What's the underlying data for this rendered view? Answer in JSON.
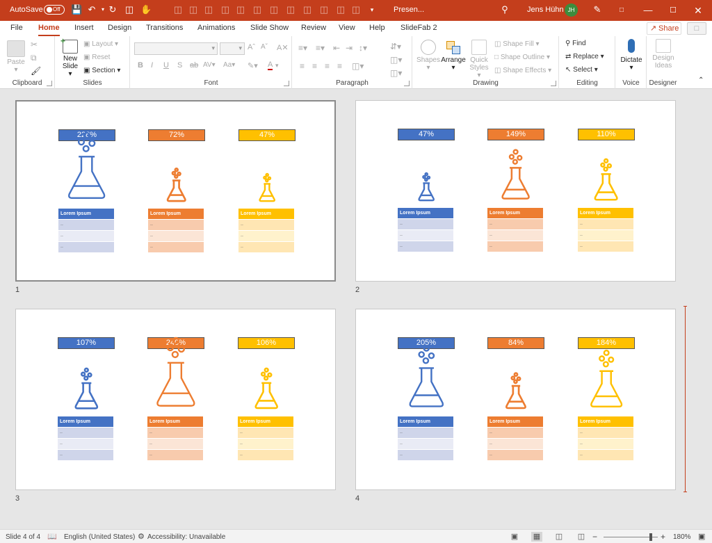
{
  "titlebar": {
    "autosave": "AutoSave",
    "toggle": "Off",
    "filename": "Presen...",
    "user": "Jens Hühn",
    "initials": "JH"
  },
  "tabs": [
    "File",
    "Home",
    "Insert",
    "Design",
    "Transitions",
    "Animations",
    "Slide Show",
    "Review",
    "View",
    "Help",
    "SlideFab 2"
  ],
  "share": "Share",
  "ribbon": {
    "clipboard": {
      "paste": "Paste",
      "label": "Clipboard"
    },
    "slides": {
      "new_slide_1": "New",
      "new_slide_2": "Slide",
      "layout": "Layout",
      "reset": "Reset",
      "section": "Section",
      "label": "Slides"
    },
    "font": {
      "label": "Font"
    },
    "paragraph": {
      "label": "Paragraph"
    },
    "drawing": {
      "shapes": "Shapes",
      "arrange": "Arrange",
      "quick_styles_1": "Quick",
      "quick_styles_2": "Styles",
      "shape_fill": "Shape Fill",
      "shape_outline": "Shape Outline",
      "shape_effects": "Shape Effects",
      "label": "Drawing"
    },
    "editing": {
      "find": "Find",
      "replace": "Replace",
      "select": "Select",
      "label": "Editing"
    },
    "voice": {
      "dictate": "Dictate",
      "label": "Voice"
    },
    "designer": {
      "design_ideas_1": "Design",
      "design_ideas_2": "Ideas",
      "label": "Designer"
    }
  },
  "colors": {
    "accent": "#c43e1c",
    "blue": "#4472c4",
    "orange": "#ed7d31",
    "gold": "#ffc000"
  },
  "slides": [
    {
      "number": "1",
      "values": [
        "228%",
        "72%",
        "47%"
      ]
    },
    {
      "number": "2",
      "values": [
        "47%",
        "149%",
        "110%"
      ]
    },
    {
      "number": "3",
      "values": [
        "107%",
        "240%",
        "106%"
      ]
    },
    {
      "number": "4",
      "values": [
        "205%",
        "84%",
        "184%"
      ]
    }
  ],
  "table_header": "Lorem Ipsum",
  "table_cell": "..",
  "status": {
    "slide_of": "Slide 4 of 4",
    "language": "English (United States)",
    "accessibility": "Accessibility: Unavailable",
    "zoom": "180%"
  }
}
